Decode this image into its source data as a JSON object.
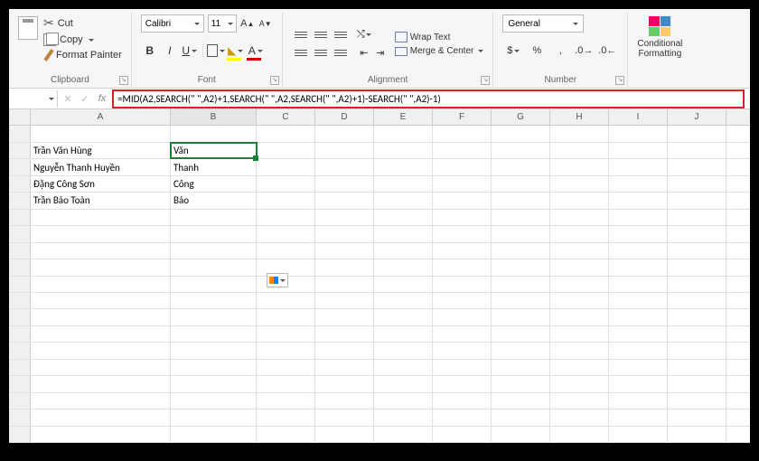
{
  "clipboard": {
    "cut": "Cut",
    "copy": "Copy",
    "painter": "Format Painter",
    "label": "Clipboard"
  },
  "font": {
    "name": "Calibri",
    "size": "11",
    "incA": "A",
    "decA": "A",
    "b": "B",
    "i": "I",
    "u": "U",
    "label": "Font"
  },
  "align": {
    "wrap": "Wrap Text",
    "merge": "Merge & Center",
    "label": "Alignment"
  },
  "number": {
    "format": "General",
    "dollar": "$",
    "percent": "%",
    "comma": ",",
    "inc": ".0₀₀",
    "dec": ".0₀",
    "label": "Number"
  },
  "styles": {
    "cf": "Conditional\nFormatting"
  },
  "formula_bar": {
    "fx": "fx",
    "formula": "=MID(A2,SEARCH(\" \",A2)+1,SEARCH(\" \",A2,SEARCH(\" \",A2)+1)-SEARCH(\" \",A2)-1)"
  },
  "columns": [
    "A",
    "B",
    "C",
    "D",
    "E",
    "F",
    "G",
    "H",
    "I",
    "J"
  ],
  "rows": [
    {
      "a": "",
      "b": ""
    },
    {
      "a": "Trần Văn Hùng",
      "b": "Văn"
    },
    {
      "a": "Nguyễn Thanh Huyền",
      "b": "Thanh"
    },
    {
      "a": "Đặng Công Sơn",
      "b": "Công"
    },
    {
      "a": "Trần Bảo Toàn",
      "b": "Bảo"
    }
  ]
}
